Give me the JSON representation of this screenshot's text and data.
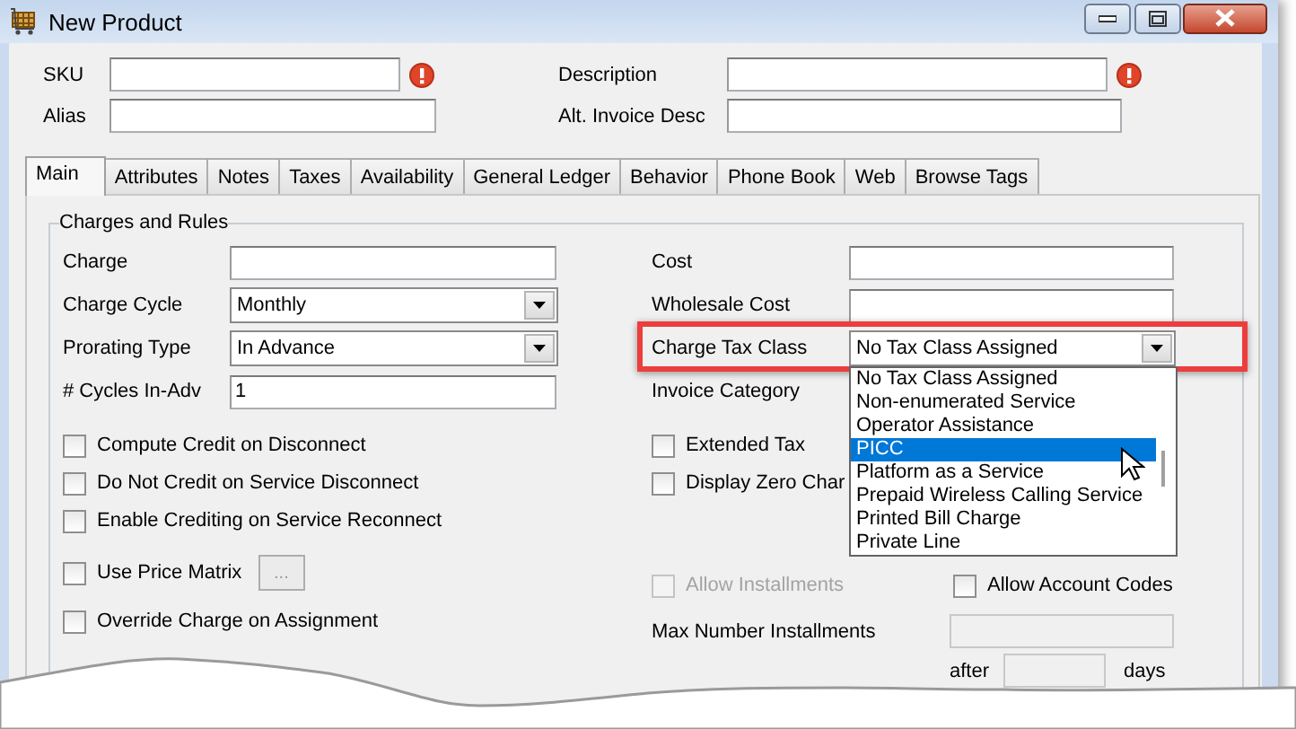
{
  "window": {
    "title": "New Product"
  },
  "header_fields": [
    {
      "label": "SKU",
      "required": true
    },
    {
      "label": "Description",
      "required": true
    },
    {
      "label": "Alias",
      "required": false
    },
    {
      "label": "Alt. Invoice Desc",
      "required": false
    }
  ],
  "tabs": [
    {
      "label": "Main",
      "selected": true
    },
    {
      "label": "Attributes",
      "selected": false
    },
    {
      "label": "Notes",
      "selected": false
    },
    {
      "label": "Taxes",
      "selected": false
    },
    {
      "label": "Availability",
      "selected": false
    },
    {
      "label": "General Ledger",
      "selected": false
    },
    {
      "label": "Behavior",
      "selected": false
    },
    {
      "label": "Phone Book",
      "selected": false
    },
    {
      "label": "Web",
      "selected": false
    },
    {
      "label": "Browse Tags",
      "selected": false
    }
  ],
  "group": {
    "title": "Charges and Rules"
  },
  "left_fields": [
    {
      "label": "Charge",
      "kind": "text"
    },
    {
      "label": "Charge Cycle",
      "kind": "combo",
      "value": "Monthly"
    },
    {
      "label": "Prorating Type",
      "kind": "combo",
      "value": "In Advance"
    },
    {
      "label": "# Cycles In-Adv",
      "kind": "text",
      "value": "1"
    }
  ],
  "right_fields": [
    {
      "label": "Cost",
      "kind": "text"
    },
    {
      "label": "Wholesale Cost",
      "kind": "text"
    },
    {
      "label": "Charge Tax Class",
      "kind": "combo",
      "value": "No Tax Class Assigned",
      "highlighted": true,
      "expanded": true
    },
    {
      "label": "Invoice Category",
      "kind": "label"
    }
  ],
  "tax_class_options": [
    {
      "label": "No Tax Class Assigned",
      "selected": false
    },
    {
      "label": "Non-enumerated Service",
      "selected": false
    },
    {
      "label": "Operator Assistance",
      "selected": false
    },
    {
      "label": "PICC",
      "selected": true
    },
    {
      "label": "Platform as a Service",
      "selected": false
    },
    {
      "label": "Prepaid Wireless Calling Service",
      "selected": false
    },
    {
      "label": "Printed Bill Charge",
      "selected": false
    },
    {
      "label": "Private Line",
      "selected": false
    }
  ],
  "left_checks": [
    {
      "label": "Compute Credit on Disconnect",
      "checked": false,
      "kind": "plain"
    },
    {
      "label": "Do Not Credit on Service Disconnect",
      "checked": false,
      "kind": "plain"
    },
    {
      "label": "Enable Crediting on Service Reconnect",
      "checked": false,
      "kind": "plain"
    },
    {
      "label": "Use Price Matrix",
      "checked": false,
      "kind": "button",
      "button": "..."
    },
    {
      "label": "Override Charge on Assignment",
      "checked": false,
      "kind": "plain"
    }
  ],
  "right_checks": [
    {
      "label": "Extended Tax",
      "checked": false
    },
    {
      "label": "Display Zero Char",
      "checked": false
    }
  ],
  "installments": {
    "allow_installments": {
      "label": "Allow Installments",
      "checked": false,
      "disabled": true
    },
    "allow_account_codes": {
      "label": "Allow Account Codes",
      "checked": false,
      "disabled": false
    },
    "max_label": "Max Number Installments",
    "max_disabled": true,
    "after_label": "after",
    "days_label": "days"
  }
}
